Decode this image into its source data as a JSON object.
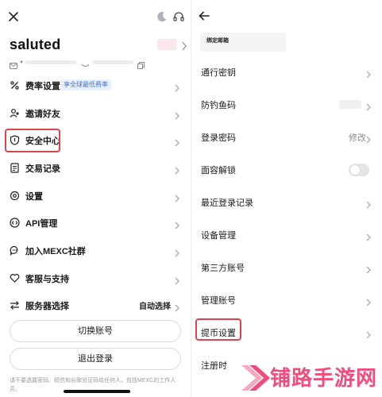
{
  "left": {
    "username": "saluted",
    "menu": [
      {
        "label": "费率设置",
        "badge": "享全球最低费率",
        "icon": "percent-icon"
      },
      {
        "label": "邀请好友",
        "icon": "invite-user-icon"
      },
      {
        "label": "安全中心",
        "icon": "shield-icon",
        "highlighted": true
      },
      {
        "label": "交易记录",
        "icon": "document-icon"
      },
      {
        "label": "设置",
        "icon": "gear-icon"
      },
      {
        "label": "API管理",
        "icon": "api-icon"
      },
      {
        "label": "加入MEXC社群",
        "icon": "chat-bubble-icon"
      },
      {
        "label": "客服与支持",
        "icon": "heart-hand-icon"
      },
      {
        "label": "服务器选择",
        "value": "自动选择",
        "icon": "server-switch-icon"
      }
    ],
    "switch_account": "切换账号",
    "logout": "退出登录",
    "disclaimer": "请不要透露密码、短信和谷歌验证码给任何人，包括MEXC的工作人员。"
  },
  "right": {
    "email_label": "绑定邮箱",
    "rows": [
      {
        "label": "通行密钥"
      },
      {
        "label": "防钓鱼码"
      },
      {
        "label": "登录密码",
        "value": "修改"
      },
      {
        "label": "面容解锁"
      },
      {
        "label": "最近登录记录"
      },
      {
        "label": "设备管理"
      },
      {
        "label": "第三方账号"
      },
      {
        "label": "管理账号"
      },
      {
        "label": "提币设置",
        "highlighted": true
      },
      {
        "label": "注册时"
      }
    ],
    "face_unlock_enabled": false
  },
  "watermark": {
    "text": "铺路手游网"
  },
  "colors": {
    "highlight": "#e0434f",
    "badge_text": "#3b74d6",
    "badge_bg": "#e8f0fd",
    "watermark": "#f04d7c"
  }
}
